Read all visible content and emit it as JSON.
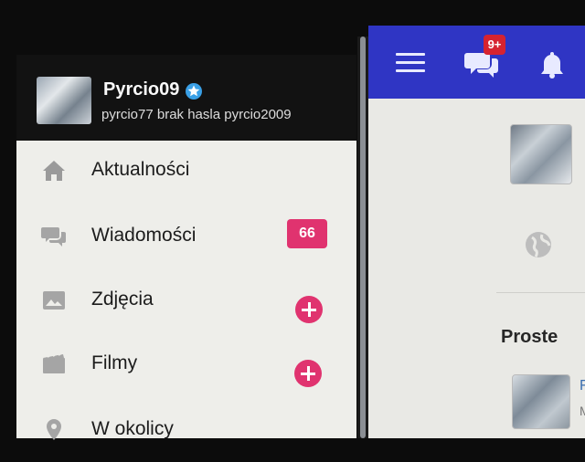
{
  "header": {
    "notifications_badge": "9+"
  },
  "profile": {
    "name": "Pyrcio09",
    "status": "pyrcio77 brak hasla pyrcio2009"
  },
  "nav": {
    "items": [
      {
        "label": "Aktualności",
        "icon": "home-icon"
      },
      {
        "label": "Wiadomości",
        "icon": "chat-icon",
        "badge": "66"
      },
      {
        "label": "Zdjęcia",
        "icon": "photo-icon",
        "action": "add"
      },
      {
        "label": "Filmy",
        "icon": "film-icon",
        "action": "add"
      },
      {
        "label": "W okolicy",
        "icon": "location-pin-icon"
      }
    ]
  },
  "feed": {
    "tab_label": "Proste",
    "post_snippet_1": "F",
    "post_snippet_2": "M"
  },
  "colors": {
    "topbar": "#2f35c4",
    "accent_pink": "#e0336f",
    "badge_red": "#d62330",
    "drawer_header": "#121212",
    "drawer_body": "#eeeeea"
  }
}
